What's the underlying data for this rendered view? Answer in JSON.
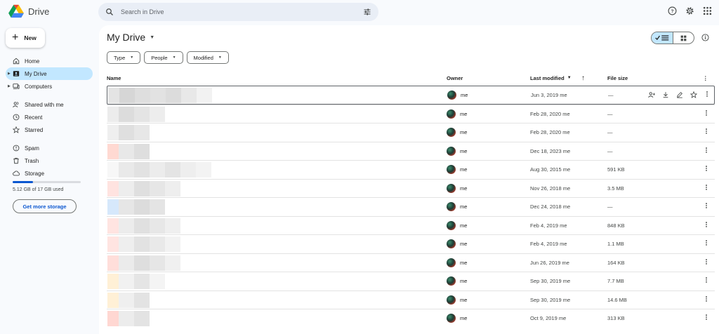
{
  "app": {
    "name": "Drive"
  },
  "search": {
    "placeholder": "Search in Drive"
  },
  "sidebar": {
    "new_label": "New",
    "items": [
      {
        "label": "Home",
        "icon": "home-icon"
      },
      {
        "label": "My Drive",
        "icon": "my-drive-icon",
        "active": true
      },
      {
        "label": "Computers",
        "icon": "computer-icon"
      },
      {
        "label": "Shared with me",
        "icon": "shared-icon"
      },
      {
        "label": "Recent",
        "icon": "clock-icon"
      },
      {
        "label": "Starred",
        "icon": "star-icon"
      },
      {
        "label": "Spam",
        "icon": "spam-icon"
      },
      {
        "label": "Trash",
        "icon": "trash-icon"
      },
      {
        "label": "Storage",
        "icon": "cloud-icon"
      }
    ],
    "storage_used_fraction": 0.3,
    "storage_text": "5.12 GB of 17 GB used",
    "storage_button": "Get more storage"
  },
  "main": {
    "title": "My Drive",
    "filters": [
      {
        "label": "Type"
      },
      {
        "label": "People"
      },
      {
        "label": "Modified"
      }
    ],
    "columns": {
      "name": "Name",
      "owner": "Owner",
      "modified": "Last modified",
      "size": "File size"
    },
    "rows": [
      {
        "owner": "me",
        "modified": "Jun 3, 2019 me",
        "size": "—"
      },
      {
        "owner": "me",
        "modified": "Feb 28, 2020 me",
        "size": "—"
      },
      {
        "owner": "me",
        "modified": "Feb 28, 2020 me",
        "size": "—"
      },
      {
        "owner": "me",
        "modified": "Dec 18, 2023 me",
        "size": "—"
      },
      {
        "owner": "me",
        "modified": "Aug 30, 2015 me",
        "size": "591 KB"
      },
      {
        "owner": "me",
        "modified": "Nov 26, 2018 me",
        "size": "3.5 MB"
      },
      {
        "owner": "me",
        "modified": "Dec 24, 2018 me",
        "size": "—"
      },
      {
        "owner": "me",
        "modified": "Feb 4, 2019 me",
        "size": "848 KB"
      },
      {
        "owner": "me",
        "modified": "Feb 4, 2019 me",
        "size": "1.1 MB"
      },
      {
        "owner": "me",
        "modified": "Jun 26, 2019 me",
        "size": "164 KB"
      },
      {
        "owner": "me",
        "modified": "Sep 30, 2019 me",
        "size": "7.7 MB"
      },
      {
        "owner": "me",
        "modified": "Sep 30, 2019 me",
        "size": "14.6 MB"
      },
      {
        "owner": "me",
        "modified": "Oct 9, 2019 me",
        "size": "313 KB"
      }
    ]
  }
}
